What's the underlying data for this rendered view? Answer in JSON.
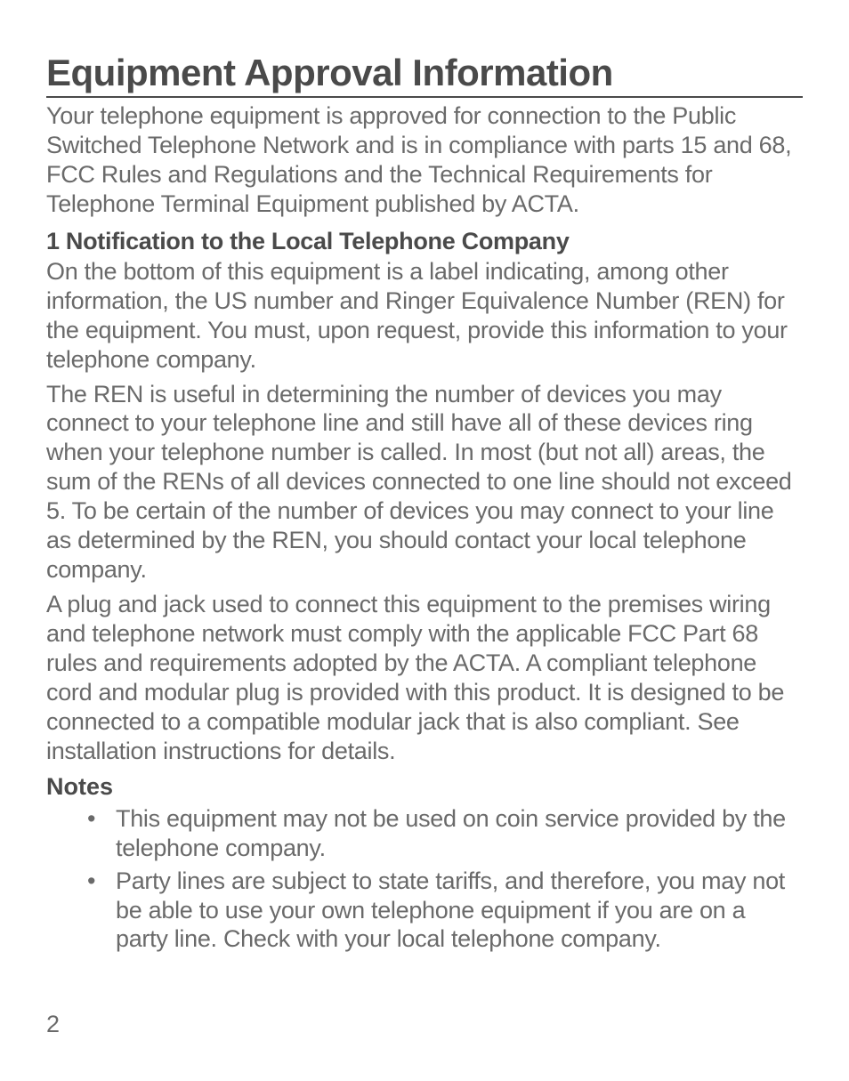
{
  "heading": "Equipment Approval Information",
  "intro": "Your telephone equipment is approved for connection to the Public Switched Telephone Network and is in compliance with parts 15 and 68, FCC Rules and Regulations and the Technical Requirements for Telephone Terminal Equipment published by ACTA.",
  "section1": {
    "title": "1 Notification to the Local Telephone Company",
    "p1": "On the bottom of this equipment is a label indicating, among other information, the US number and Ringer Equivalence Number (REN) for the equipment. You must, upon request, provide this information to your telephone company.",
    "p2": "The REN is useful in determining the number of devices you may connect to your telephone line and still have all of these devices ring when your telephone number is called. In most (but not all) areas, the sum of the RENs of all devices connected to one line should not exceed 5. To be certain of the number of devices you may connect to your line as determined by the REN, you should contact your local telephone company.",
    "p3": "A plug and jack used to connect this equipment to the premises wiring and telephone network must comply with the applicable FCC Part 68 rules and requirements adopted by the ACTA. A compliant telephone cord and modular plug is provided with this product. It is designed to be connected to a compatible modular jack that is also compliant. See installation instructions for details."
  },
  "notes": {
    "title": "Notes",
    "items": [
      "This equipment may not be used on coin service provided by the telephone company.",
      "Party lines are subject to state tariffs, and therefore, you may not be able to use your own telephone equipment if you are on a party line. Check with your local telephone company."
    ]
  },
  "pageNumber": "2"
}
